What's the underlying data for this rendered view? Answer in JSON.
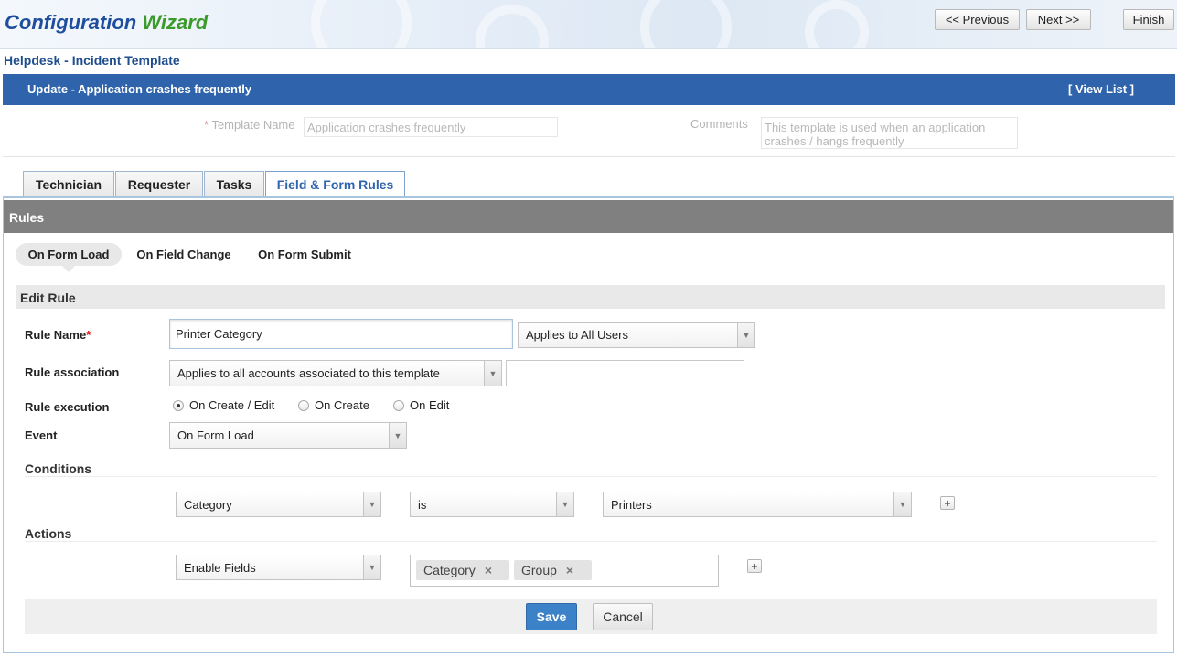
{
  "header": {
    "title_part1": "Configuration",
    "title_part2": "Wizard",
    "prev_label": "<< Previous",
    "next_label": "Next >>",
    "finish_label": "Finish"
  },
  "subtitle": "Helpdesk - Incident Template",
  "bar": {
    "title": "Update - Application crashes frequently",
    "view_list": "[ View List ]"
  },
  "template": {
    "name_required": "*",
    "name_label": "Template Name",
    "name_value": "Application crashes frequently",
    "comments_label": "Comments",
    "comments_value": "This template is used when an application crashes / hangs frequently"
  },
  "tabs": [
    "Technician",
    "Requester",
    "Tasks",
    "Field & Form Rules"
  ],
  "rules_title": "Rules",
  "subtabs": [
    "On Form Load",
    "On Field Change",
    "On Form Submit"
  ],
  "edit_rule": {
    "title": "Edit Rule",
    "rule_name_label": "Rule Name",
    "required_mark": "*",
    "rule_name_value": "Printer Category",
    "applies_users": "Applies to All Users",
    "rule_assoc_label": "Rule association",
    "rule_assoc_value": "Applies to all accounts associated to this template",
    "rule_assoc_extra": "",
    "rule_exec_label": "Rule execution",
    "exec_options": [
      "On Create / Edit",
      "On Create",
      "On Edit"
    ],
    "exec_selected": "On Create / Edit",
    "event_label": "Event",
    "event_value": "On Form Load",
    "conditions_label": "Conditions",
    "condition": {
      "field": "Category",
      "operator": "is",
      "value": "Printers"
    },
    "actions_label": "Actions",
    "action": {
      "type": "Enable Fields",
      "tags": [
        "Category",
        "Group"
      ]
    }
  },
  "buttons": {
    "save": "Save",
    "cancel": "Cancel",
    "add": "+",
    "remove": "×"
  },
  "colors": {
    "accent_blue": "#2f64ad",
    "title_blue": "#1f4e9e",
    "title_green": "#3a9a2a",
    "save_blue": "#3b82c8",
    "rules_gray": "#808080"
  },
  "icons": {
    "dropdown": "chevron-down-icon",
    "add": "plus-icon",
    "remove": "close-icon"
  }
}
